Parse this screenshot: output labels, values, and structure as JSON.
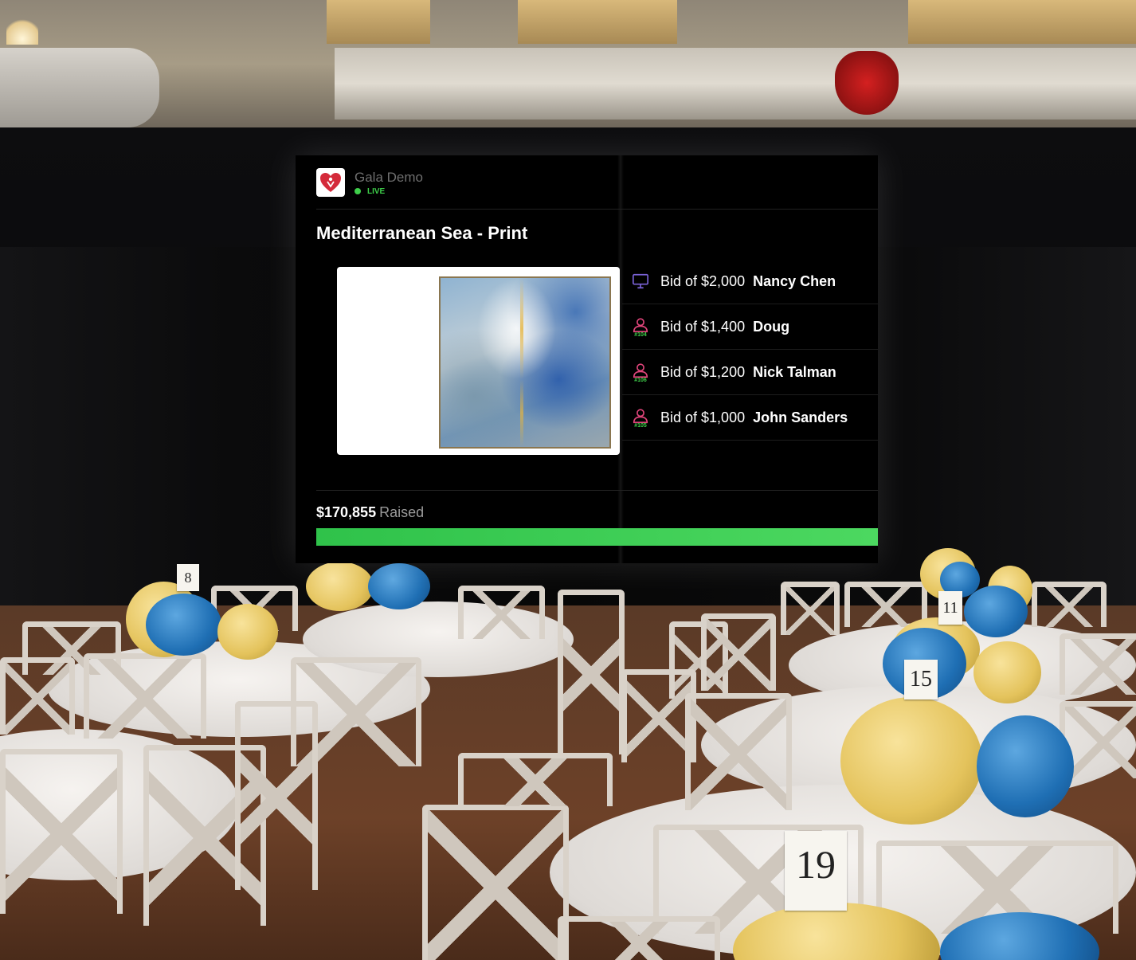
{
  "organization": {
    "name": "Gala Demo",
    "status": "LIVE"
  },
  "auction_item": {
    "title": "Mediterranean Sea - Print"
  },
  "bids": [
    {
      "amount_label": "Bid of $2,000",
      "bidder": "Nancy Chen",
      "channel": "online",
      "icon": "monitor-icon",
      "paddle": ""
    },
    {
      "amount_label": "Bid of $1,400",
      "bidder": "Doug",
      "channel": "in-room",
      "icon": "person-icon",
      "paddle": "#104"
    },
    {
      "amount_label": "Bid of $1,200",
      "bidder": "Nick Talman",
      "channel": "in-room",
      "icon": "person-icon",
      "paddle": "#106"
    },
    {
      "amount_label": "Bid of $1,000",
      "bidder": "John Sanders",
      "channel": "in-room",
      "icon": "person-icon",
      "paddle": "#105"
    }
  ],
  "fundraising": {
    "raised_amount": "$170,855",
    "raised_label": "Raised",
    "progress_percent": 100
  },
  "table_numbers": [
    "8",
    "11",
    "15",
    "19"
  ],
  "colors": {
    "accent_green": "#3ecf4a",
    "online_icon": "#7b63d8",
    "in_room_icon": "#e0457b",
    "logo_red": "#d42a3a"
  }
}
